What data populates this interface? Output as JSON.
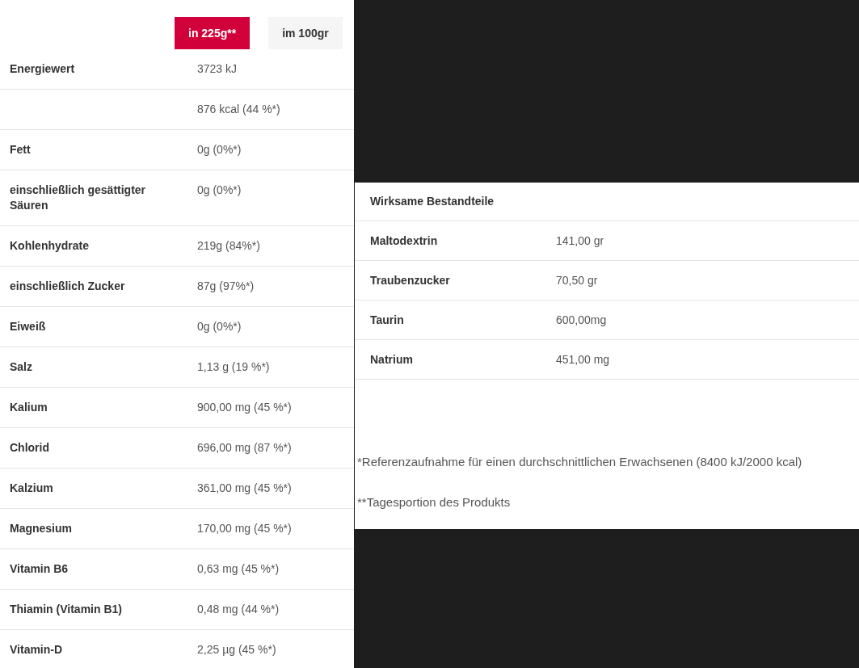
{
  "tabs": [
    {
      "label": "in 225g**",
      "selected": true
    },
    {
      "label": "im 100gr",
      "selected": false
    }
  ],
  "nutrition_rows": [
    {
      "label": "Energiewert",
      "value": "3723 kJ"
    },
    {
      "label": "",
      "value": "876 kcal (44 %*)"
    },
    {
      "label": "Fett",
      "value": "0g (0%*)"
    },
    {
      "label": "einschließlich gesättigter Säuren",
      "value": "0g (0%*)"
    },
    {
      "label": "Kohlenhydrate",
      "value": "219g (84%*)"
    },
    {
      "label": "einschließlich Zucker",
      "value": "87g (97%*)"
    },
    {
      "label": "Eiweiß",
      "value": "0g (0%*)"
    },
    {
      "label": "Salz",
      "value": "1,13 g (19 %*)"
    },
    {
      "label": "Kalium",
      "value": "900,00 mg (45 %*)"
    },
    {
      "label": "Chlorid",
      "value": "696,00 mg (87 %*)"
    },
    {
      "label": "Kalzium",
      "value": "361,00 mg (45 %*)"
    },
    {
      "label": "Magnesium",
      "value": "170,00 mg (45 %*)"
    },
    {
      "label": "Vitamin B6",
      "value": "0,63 mg (45 %*)"
    },
    {
      "label": "Thiamin (Vitamin B1)",
      "value": "0,48 mg (44 %*)"
    },
    {
      "label": "Vitamin-D",
      "value": "2,25 µg (45 %*)"
    }
  ],
  "ingredients": {
    "title": "Wirksame Bestandteile",
    "rows": [
      {
        "label": "Maltodextrin",
        "value": "141,00 gr"
      },
      {
        "label": "Traubenzucker",
        "value": "70,50 gr"
      },
      {
        "label": "Taurin",
        "value": "600,00mg"
      },
      {
        "label": "Natrium",
        "value": "451,00 mg"
      }
    ]
  },
  "footnotes": [
    "*Referenzaufnahme für einen durchschnittlichen Erwachsenen (8400 kJ/2000 kcal)",
    "**Tagesportion des Produkts"
  ]
}
